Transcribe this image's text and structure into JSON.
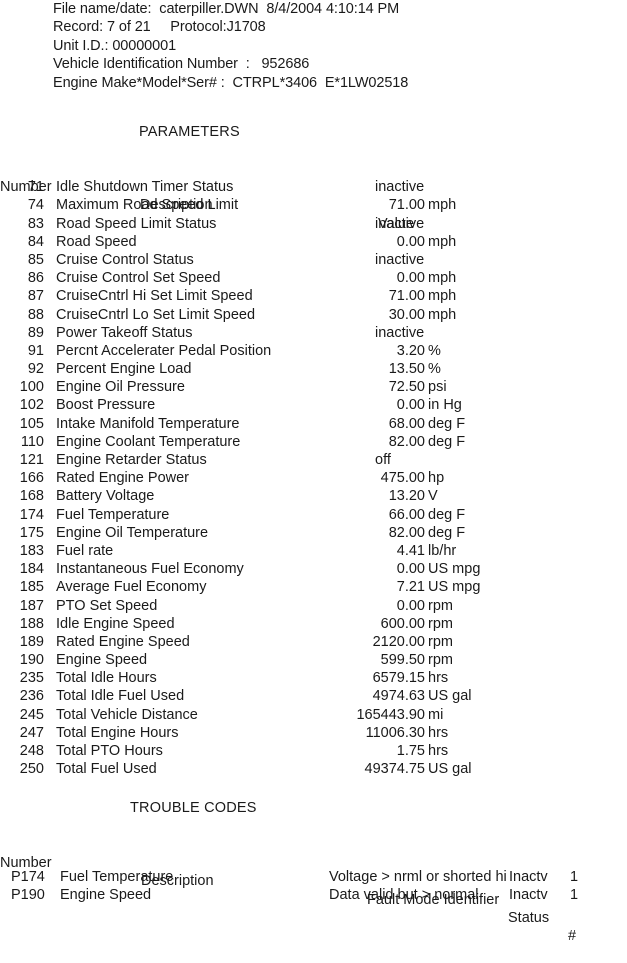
{
  "header": {
    "lines": [
      "File name/date:  caterpiller.DWN  8/4/2004 4:10:14 PM",
      "Record: 7 of 21     Protocol:J1708",
      "Unit I.D.: 00000001",
      "Vehicle Identification Number  :   952686",
      "Engine Make*Model*Ser# :  CTRPL*3406  E*1LW02518"
    ],
    "file_name": "caterpiller.DWN",
    "file_date": "8/4/2004 4:10:14 PM",
    "record": "7 of 21",
    "protocol": "J1708",
    "unit_id": "00000001",
    "vin": "952686",
    "engine_make_model_ser": "CTRPL*3406  E*1LW02518"
  },
  "parameters_section": {
    "title": "PARAMETERS",
    "columns": {
      "number": "Number",
      "description": "Description",
      "value": "Value"
    },
    "rows": [
      {
        "number": "71",
        "description": "Idle Shutdown Timer Status",
        "value_num": "",
        "value_unit": "",
        "value_text": "inactive"
      },
      {
        "number": "74",
        "description": "Maximum Road Speed Limit",
        "value_num": "71.00",
        "value_unit": "mph",
        "value_text": ""
      },
      {
        "number": "83",
        "description": "Road Speed Limit Status",
        "value_num": "",
        "value_unit": "",
        "value_text": "inactive"
      },
      {
        "number": "84",
        "description": "Road Speed",
        "value_num": "0.00",
        "value_unit": "mph",
        "value_text": ""
      },
      {
        "number": "85",
        "description": "Cruise Control Status",
        "value_num": "",
        "value_unit": "",
        "value_text": "inactive"
      },
      {
        "number": "86",
        "description": "Cruise Control Set Speed",
        "value_num": "0.00",
        "value_unit": "mph",
        "value_text": ""
      },
      {
        "number": "87",
        "description": "CruiseCntrl Hi Set Limit Speed",
        "value_num": "71.00",
        "value_unit": "mph",
        "value_text": ""
      },
      {
        "number": "88",
        "description": "CruiseCntrl Lo Set Limit Speed",
        "value_num": "30.00",
        "value_unit": "mph",
        "value_text": ""
      },
      {
        "number": "89",
        "description": "Power Takeoff Status",
        "value_num": "",
        "value_unit": "",
        "value_text": "inactive"
      },
      {
        "number": "91",
        "description": "Percnt Accelerater Pedal Position",
        "value_num": "3.20",
        "value_unit": "%",
        "value_text": ""
      },
      {
        "number": "92",
        "description": "Percent Engine Load",
        "value_num": "13.50",
        "value_unit": "%",
        "value_text": ""
      },
      {
        "number": "100",
        "description": "Engine Oil Pressure",
        "value_num": "72.50",
        "value_unit": "psi",
        "value_text": ""
      },
      {
        "number": "102",
        "description": "Boost Pressure",
        "value_num": "0.00",
        "value_unit": "in Hg",
        "value_text": ""
      },
      {
        "number": "105",
        "description": "Intake Manifold Temperature",
        "value_num": "68.00",
        "value_unit": "deg F",
        "value_text": ""
      },
      {
        "number": "110",
        "description": "Engine Coolant Temperature",
        "value_num": "82.00",
        "value_unit": "deg F",
        "value_text": ""
      },
      {
        "number": "121",
        "description": "Engine Retarder Status",
        "value_num": "",
        "value_unit": "",
        "value_text": "off"
      },
      {
        "number": "166",
        "description": "Rated Engine Power",
        "value_num": "475.00",
        "value_unit": "hp",
        "value_text": ""
      },
      {
        "number": "168",
        "description": "Battery Voltage",
        "value_num": "13.20",
        "value_unit": "V",
        "value_text": ""
      },
      {
        "number": "174",
        "description": "Fuel Temperature",
        "value_num": "66.00",
        "value_unit": "deg F",
        "value_text": ""
      },
      {
        "number": "175",
        "description": "Engine Oil Temperature",
        "value_num": "82.00",
        "value_unit": "deg F",
        "value_text": ""
      },
      {
        "number": "183",
        "description": "Fuel rate",
        "value_num": "4.41",
        "value_unit": "lb/hr",
        "value_text": ""
      },
      {
        "number": "184",
        "description": "Instantaneous Fuel Economy",
        "value_num": "0.00",
        "value_unit": "US mpg",
        "value_text": ""
      },
      {
        "number": "185",
        "description": "Average Fuel Economy",
        "value_num": "7.21",
        "value_unit": "US mpg",
        "value_text": ""
      },
      {
        "number": "187",
        "description": "PTO Set Speed",
        "value_num": "0.00",
        "value_unit": "rpm",
        "value_text": ""
      },
      {
        "number": "188",
        "description": "Idle Engine Speed",
        "value_num": "600.00",
        "value_unit": "rpm",
        "value_text": ""
      },
      {
        "number": "189",
        "description": "Rated Engine Speed",
        "value_num": "2120.00",
        "value_unit": "rpm",
        "value_text": ""
      },
      {
        "number": "190",
        "description": "Engine Speed",
        "value_num": "599.50",
        "value_unit": "rpm",
        "value_text": ""
      },
      {
        "number": "235",
        "description": "Total Idle Hours",
        "value_num": "6579.15",
        "value_unit": "hrs",
        "value_text": ""
      },
      {
        "number": "236",
        "description": "Total Idle Fuel Used",
        "value_num": "4974.63",
        "value_unit": "US gal",
        "value_text": ""
      },
      {
        "number": "245",
        "description": "Total Vehicle Distance",
        "value_num": "165443.90",
        "value_unit": "mi",
        "value_text": ""
      },
      {
        "number": "247",
        "description": "Total Engine Hours",
        "value_num": "11006.30",
        "value_unit": "hrs",
        "value_text": ""
      },
      {
        "number": "248",
        "description": "Total PTO Hours",
        "value_num": "1.75",
        "value_unit": "hrs",
        "value_text": ""
      },
      {
        "number": "250",
        "description": "Total Fuel Used",
        "value_num": "49374.75",
        "value_unit": "US gal",
        "value_text": ""
      }
    ]
  },
  "trouble_codes_section": {
    "title": "TROUBLE CODES",
    "columns": {
      "number": "Number",
      "description": "Description",
      "fmi": "Fault Mode Identifier",
      "status": "Status",
      "count": "#"
    },
    "rows": [
      {
        "number": "P174",
        "description": "Fuel Temperature",
        "fmi": "Voltage > nrml or shorted hi",
        "status": "Inactv",
        "count": "1"
      },
      {
        "number": "P190",
        "description": "Engine Speed",
        "fmi": "Data valid but > normal",
        "status": "Inactv",
        "count": "1"
      }
    ]
  }
}
